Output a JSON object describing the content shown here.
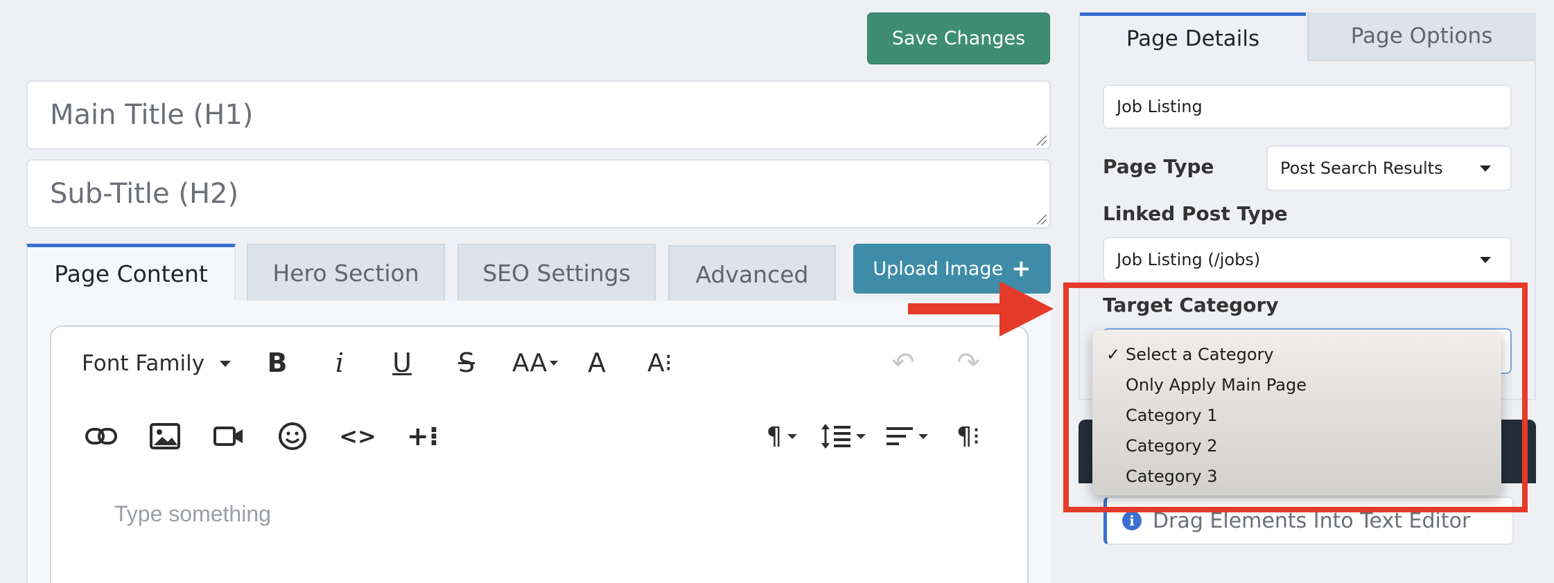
{
  "header": {
    "save_label": "Save Changes"
  },
  "title_fields": {
    "main_placeholder": "Main Title (H1)",
    "sub_placeholder": "Sub-Title (H2)"
  },
  "editor_tabs": [
    {
      "label": "Page Content",
      "active": true
    },
    {
      "label": "Hero Section",
      "active": false
    },
    {
      "label": "SEO Settings",
      "active": false
    },
    {
      "label": "Advanced",
      "active": false
    }
  ],
  "upload_button": {
    "label": "Upload Image",
    "icon": "plus-icon"
  },
  "toolbar": {
    "font_family_label": "Font Family",
    "row1_icons": [
      "bold-icon",
      "italic-icon",
      "underline-icon",
      "strikethrough-icon",
      "font-size-icon",
      "text-color-icon",
      "more-text-icon",
      "undo-icon",
      "redo-icon"
    ],
    "row2_icons": [
      "link-icon",
      "image-icon",
      "video-icon",
      "emoji-icon",
      "code-icon",
      "insert-more-icon",
      "paragraph-format-icon",
      "line-height-icon",
      "align-icon",
      "paragraph-more-icon"
    ],
    "glyphs": {
      "bold": "B",
      "italic": "i",
      "underline": "U",
      "strike": "S",
      "font_size": "AA",
      "text_color": "A",
      "more_text": "A⁝",
      "undo": "↶",
      "redo": "↷",
      "code": "<>",
      "insert_more": "+⁝",
      "paragraph": "¶",
      "paragraph_more": "¶⁝"
    }
  },
  "editor": {
    "placeholder": "Type something"
  },
  "right_panel": {
    "tabs": [
      {
        "label": "Page Details",
        "active": true
      },
      {
        "label": "Page Options",
        "active": false
      }
    ],
    "page_name_value": "Job Listing",
    "page_type": {
      "label": "Page Type",
      "value": "Post Search Results"
    },
    "linked_post_type": {
      "label": "Linked Post Type",
      "value": "Job Listing (/jobs)"
    },
    "target_category": {
      "label": "Target Category",
      "options": [
        "Select a Category",
        "Only Apply Main Page",
        "Category 1",
        "Category 2",
        "Category 3"
      ],
      "selected_index": 0,
      "check": "✓"
    },
    "drag_hint": "Drag Elements Into Text Editor",
    "info_glyph": "i"
  },
  "colors": {
    "save_green": "#3e8d73",
    "upload_teal": "#3f8ca8",
    "accent_blue": "#3a6fd0",
    "annotation_red": "#e53b2a",
    "dark_bar": "#242d38"
  }
}
